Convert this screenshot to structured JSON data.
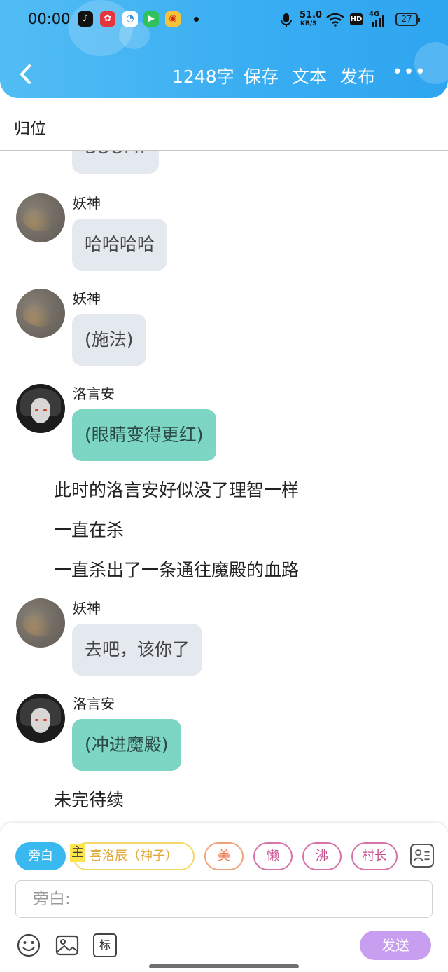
{
  "status_bar": {
    "time": "00:00",
    "network_speed": "51.0",
    "network_unit": "KB/S",
    "hd": "HD",
    "signal": "4G",
    "battery": "27"
  },
  "header": {
    "word_count": "1248字",
    "save_label": "保存",
    "text_label": "文本",
    "publish_label": "发布",
    "more_label": "•••"
  },
  "subbar": {
    "reset_label": "归位"
  },
  "chat": {
    "partial_bubble": "BOOM!",
    "messages": [
      {
        "speaker": "妖神",
        "text": "哈哈哈哈"
      },
      {
        "speaker": "妖神",
        "text": "(施法)"
      },
      {
        "speaker": "洛言安",
        "text": "(眼睛变得更红)"
      },
      {
        "speaker": "妖神",
        "text": "去吧，该你了"
      },
      {
        "speaker": "洛言安",
        "text": "(冲进魔殿)"
      }
    ],
    "narration": [
      "此时的洛言安好似没了理智一样",
      "一直在杀",
      "一直杀出了一条通往魔殿的血路",
      "未完待续"
    ]
  },
  "composer": {
    "roles": [
      {
        "label": "旁白",
        "color": "#39b9f0"
      },
      {
        "label": "喜洛辰（神子）",
        "color": "#f4d86a"
      },
      {
        "label": "美",
        "color": "#f0a27a"
      },
      {
        "label": "懒",
        "color": "#d773a9"
      },
      {
        "label": "沸",
        "color": "#d773a9"
      },
      {
        "label": "村长",
        "color": "#d773a9"
      }
    ],
    "host_tag": "主",
    "input_placeholder": "旁白:",
    "mark_label": "标",
    "send_label": "发送"
  }
}
